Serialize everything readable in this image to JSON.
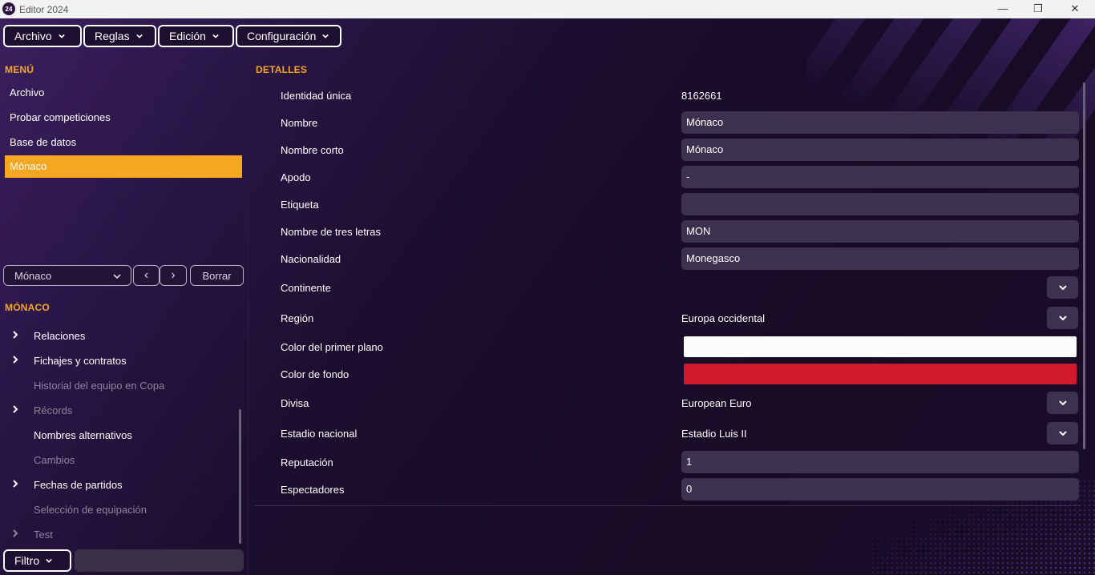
{
  "window": {
    "logo": "24",
    "title": "Editor 2024",
    "minimize_icon": "—",
    "maximize_icon": "❐",
    "close_icon": "✕"
  },
  "menubar": [
    {
      "label": "Archivo"
    },
    {
      "label": "Reglas"
    },
    {
      "label": "Edición"
    },
    {
      "label": "Configuración"
    }
  ],
  "left_menu": {
    "title": "MENÚ",
    "items": [
      {
        "label": "Archivo"
      },
      {
        "label": "Probar competiciones"
      },
      {
        "label": "Base de datos"
      },
      {
        "label": "Mónaco",
        "active": true
      }
    ]
  },
  "picker": {
    "value": "Mónaco",
    "prev_icon": "‹",
    "next_icon": "›",
    "clear_label": "Borrar"
  },
  "entity_tree": {
    "title": "MÓNACO",
    "items": [
      {
        "label": "Relaciones",
        "expandable": true,
        "dim": false
      },
      {
        "label": "Fichajes y contratos",
        "expandable": true,
        "dim": false
      },
      {
        "label": "Historial del equipo en Copa",
        "expandable": false,
        "dim": true
      },
      {
        "label": "Récords",
        "expandable": true,
        "dim": true
      },
      {
        "label": "Nombres alternativos",
        "expandable": false,
        "dim": false
      },
      {
        "label": "Cambios",
        "expandable": false,
        "dim": true
      },
      {
        "label": "Fechas de partidos",
        "expandable": true,
        "dim": false
      },
      {
        "label": "Selección de equipación",
        "expandable": false,
        "dim": true
      },
      {
        "label": "Test",
        "expandable": true,
        "dim": true
      }
    ]
  },
  "filter": {
    "label": "Filtro",
    "value": ""
  },
  "details": {
    "title": "DETALLES",
    "identity_label": "Identidad única",
    "identity_value": "8162661",
    "name_label": "Nombre",
    "name_value": "Mónaco",
    "short_name_label": "Nombre corto",
    "short_name_value": "Mónaco",
    "nickname_label": "Apodo",
    "nickname_value": "-",
    "tag_label": "Etiqueta",
    "tag_value": "",
    "three_letter_label": "Nombre de tres letras",
    "three_letter_value": "MON",
    "nationality_label": "Nacionalidad",
    "nationality_value": "Monegasco",
    "continent_label": "Continente",
    "continent_value": "",
    "region_label": "Región",
    "region_value": "Europa occidental",
    "fg_color_label": "Color del primer plano",
    "fg_color": "#fbfbfb",
    "bg_color_label": "Color de fondo",
    "bg_color": "#d01a2c",
    "currency_label": "Divisa",
    "currency_value": "European Euro",
    "stadium_label": "Estadio nacional",
    "stadium_value": "Estadio Luis II",
    "reputation_label": "Reputación",
    "reputation_value": "1",
    "spectators_label": "Espectadores",
    "spectators_value": "0"
  },
  "colors": {
    "accent": "#f5a623",
    "field_bg": "#3c3250"
  }
}
